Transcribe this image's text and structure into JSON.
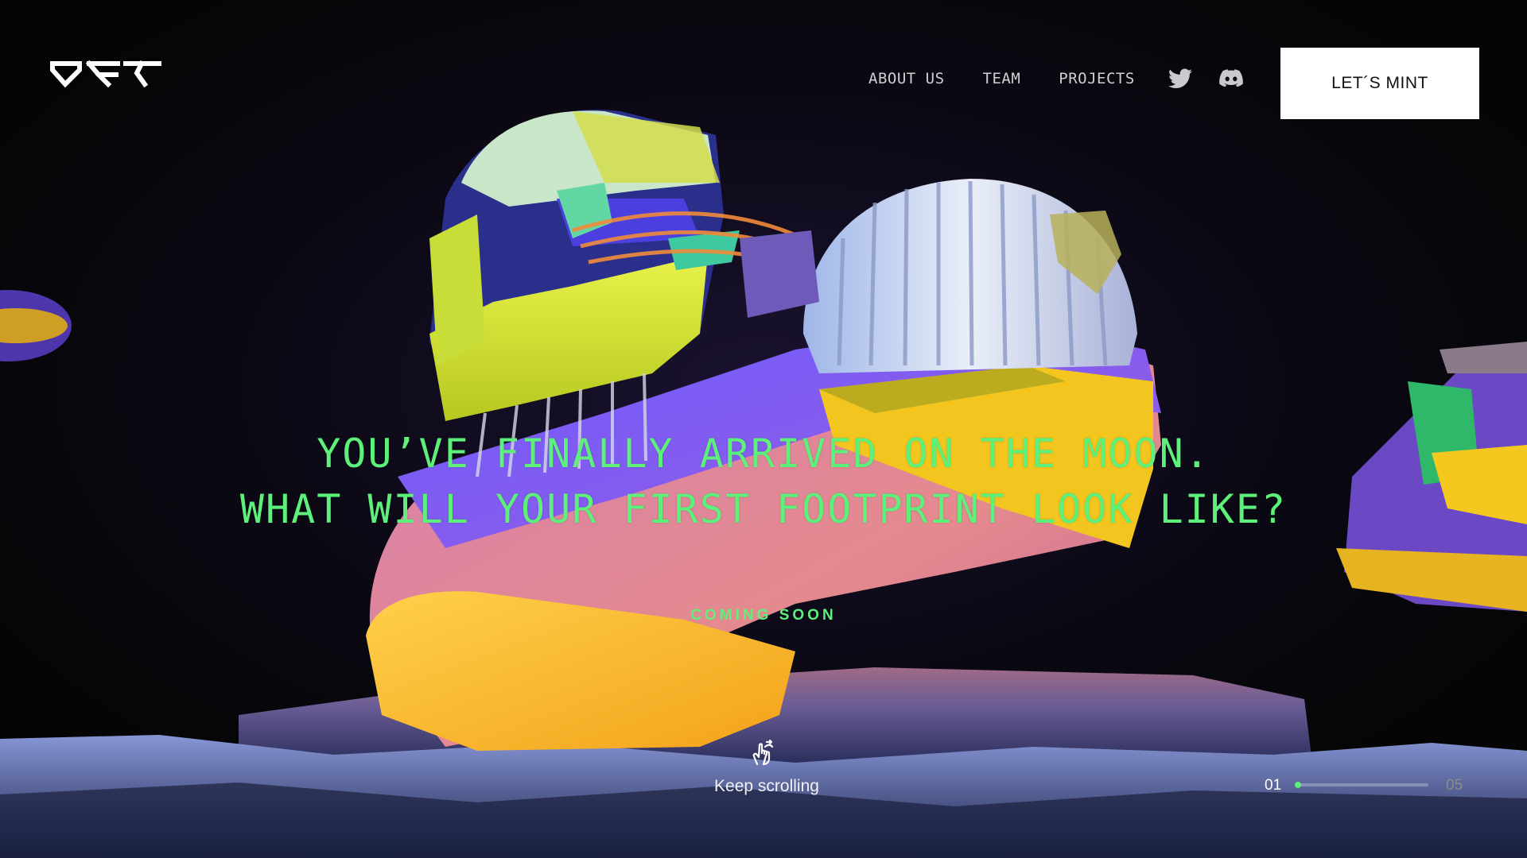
{
  "header": {
    "logo_text": "OFT",
    "nav": {
      "about": "ABOUT US",
      "team": "TEAM",
      "projects": "PROJECTS"
    },
    "social": {
      "twitter_icon": "twitter-icon",
      "discord_icon": "discord-icon"
    },
    "cta_label": "LET´S MINT"
  },
  "hero": {
    "headline_line1": "YOU’VE FINALLY ARRIVED ON THE MOON.",
    "headline_line2": "WHAT WILL YOUR FIRST FOOTPRINT LOOK LIKE?",
    "subtitle": "COMING SOON"
  },
  "scroll_hint": {
    "icon": "swipe-hand-icon",
    "label": "Keep scrolling"
  },
  "pager": {
    "current": "01",
    "total": "05",
    "progress": 0.05
  },
  "colors": {
    "accent": "#5df07a",
    "background": "#070707",
    "button_bg": "#ffffff"
  }
}
